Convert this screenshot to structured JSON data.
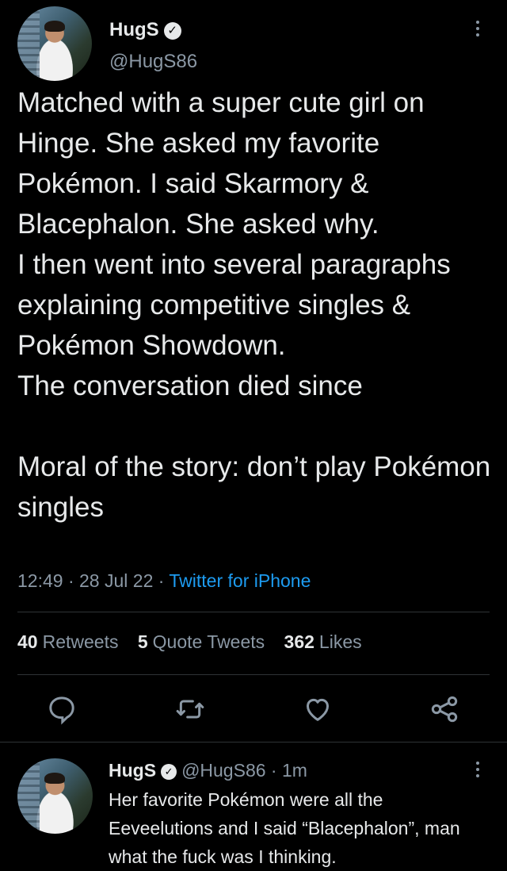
{
  "main_tweet": {
    "display_name": "HugS",
    "handle": "@HugS86",
    "text": "Matched with a super cute girl on Hinge. She asked my favorite Pokémon. I said Skarmory & Blacephalon. She asked why.\nI then went into several paragraphs explaining competitive singles & Pokémon Showdown.\nThe conversation died since\n\nMoral of the story: don’t play Pokémon singles",
    "time": "12:49",
    "date": "28 Jul 22",
    "source": "Twitter for iPhone",
    "retweets_count": "40",
    "retweets_label": "Retweets",
    "quotes_count": "5",
    "quotes_label": "Quote Tweets",
    "likes_count": "362",
    "likes_label": "Likes"
  },
  "reply_tweet": {
    "display_name": "HugS",
    "handle": "@HugS86",
    "age": "1m",
    "text": "Her favorite Pokémon were all the Eeveelutions and I said “Blacephalon”, man what the fuck was I thinking."
  },
  "icons": [
    "verified-badge-icon",
    "more-options-icon",
    "reply-icon",
    "retweet-icon",
    "like-icon",
    "share-icon"
  ],
  "colors": {
    "background": "#000000",
    "text": "#e7e9ea",
    "secondary": "#8b98a5",
    "link": "#1d9bf0"
  }
}
